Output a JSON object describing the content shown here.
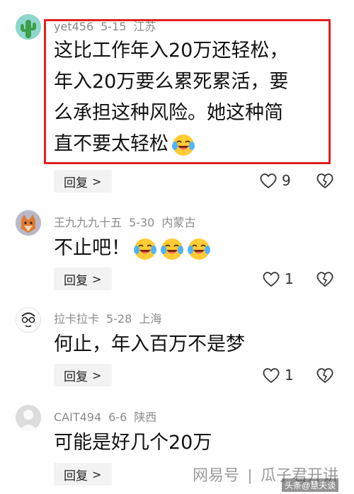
{
  "comments": [
    {
      "username": "yet456",
      "date": "5-15",
      "location": "江苏",
      "text_lines": [
        "这比工作年入20万还轻松，",
        "年入20万要么累死累活，要",
        "么承担这种风险。她这种简",
        "直不要太轻松"
      ],
      "emoji_count": 1,
      "reply_label": "回复",
      "likes": "9"
    },
    {
      "username": "王九九九十五",
      "date": "5-30",
      "location": "内蒙古",
      "text_lines": [
        "不止吧！"
      ],
      "emoji_count": 3,
      "reply_label": "回复",
      "likes": "1"
    },
    {
      "username": "拉卡拉卡",
      "date": "5-28",
      "location": "上海",
      "text_lines": [
        "何止，年入百万不是梦"
      ],
      "emoji_count": 0,
      "reply_label": "回复",
      "likes": "1"
    },
    {
      "username": "CAIT494",
      "date": "6-6",
      "location": "陕西",
      "text_lines": [
        "可能是好几个20万"
      ],
      "emoji_count": 0,
      "reply_label": "回复",
      "likes": ""
    }
  ],
  "icons": {
    "like": "heart-outline-icon",
    "dislike": "broken-heart-icon",
    "emoji": "laughing-crying-emoji",
    "reply_chevron": "chevron-right-icon"
  },
  "watermark": {
    "source": "网易号",
    "separator": "|",
    "author": "瓜子君开讲",
    "stamp": "头条@慧夫谈"
  },
  "colors": {
    "highlight_border": "#e02020",
    "meta_text": "#8a8a8a",
    "reply_bg": "#f2f2f2"
  }
}
